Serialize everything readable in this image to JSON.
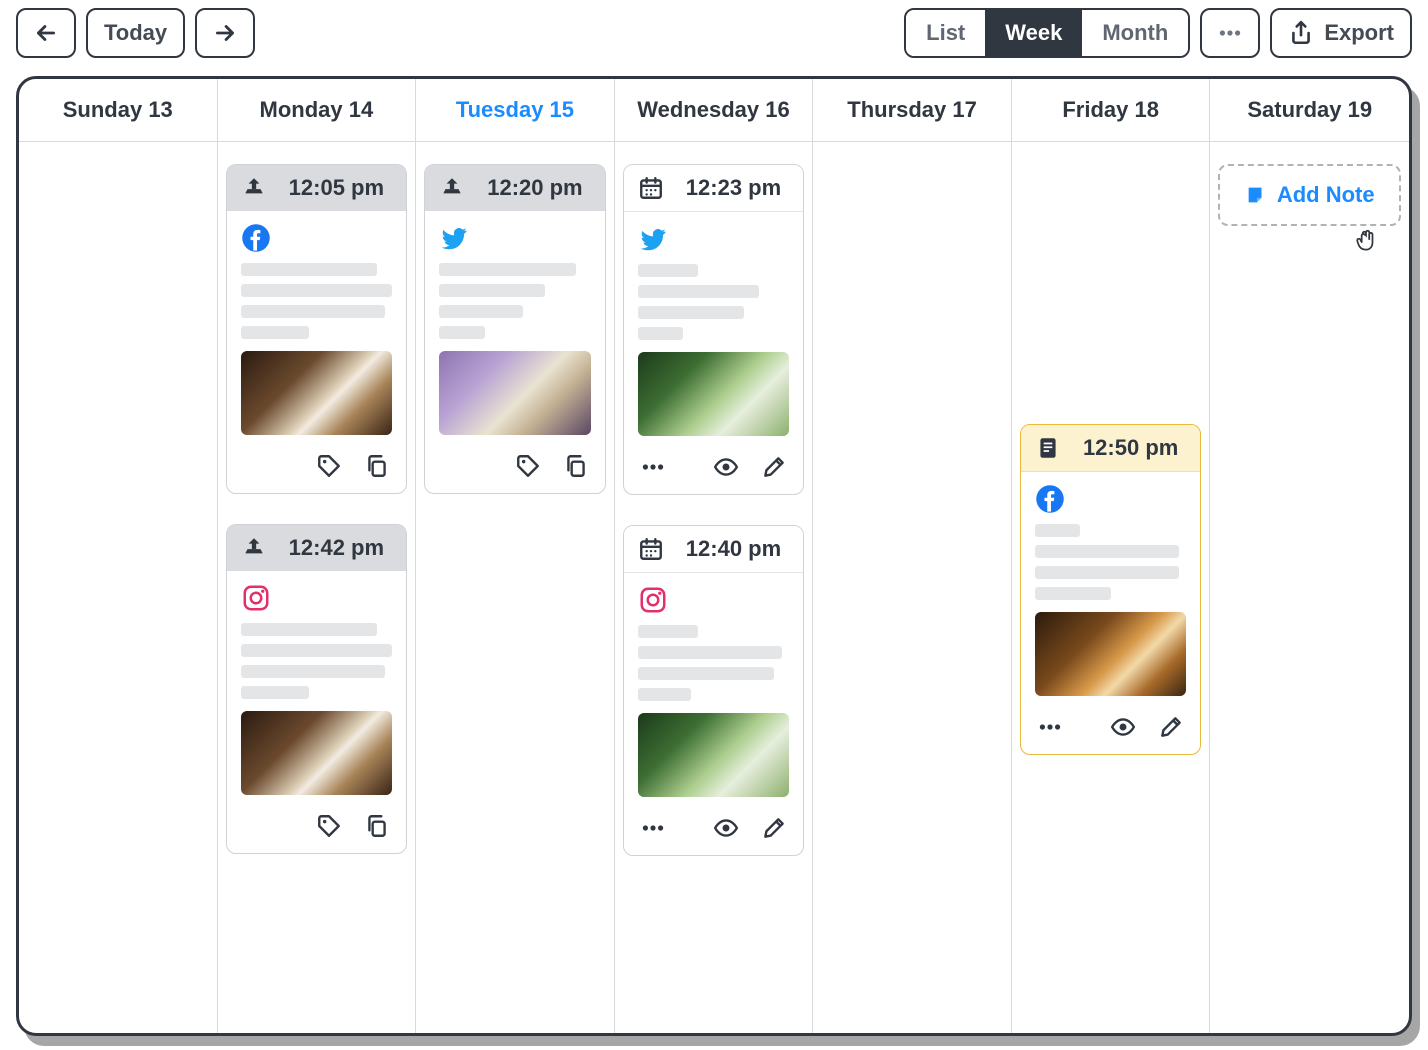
{
  "toolbar": {
    "today_label": "Today",
    "views": {
      "list": "List",
      "week": "Week",
      "month": "Month",
      "active": "week"
    },
    "export_label": "Export"
  },
  "add_note": {
    "label": "Add Note"
  },
  "days": [
    {
      "label": "Sunday 13",
      "today": false
    },
    {
      "label": "Monday 14",
      "today": false
    },
    {
      "label": "Tuesday 15",
      "today": true
    },
    {
      "label": "Wednesday 16",
      "today": false
    },
    {
      "label": "Thursday 17",
      "today": false
    },
    {
      "label": "Friday 18",
      "today": false
    },
    {
      "label": "Saturday 19",
      "today": false
    }
  ],
  "cards": {
    "mon1": {
      "time": "12:05 pm",
      "status": "queued",
      "platform": "facebook",
      "image": "coffee",
      "actions": [
        "tag",
        "copy"
      ]
    },
    "mon2": {
      "time": "12:42 pm",
      "status": "queued",
      "platform": "instagram",
      "image": "coffee",
      "actions": [
        "tag",
        "copy"
      ]
    },
    "tue1": {
      "time": "12:20 pm",
      "status": "queued",
      "platform": "twitter",
      "image": "lilac",
      "actions": [
        "tag",
        "copy"
      ]
    },
    "wed1": {
      "time": "12:23 pm",
      "status": "scheduled",
      "platform": "twitter",
      "image": "matcha",
      "actions": [
        "more",
        "view",
        "edit"
      ]
    },
    "wed2": {
      "time": "12:40 pm",
      "status": "scheduled",
      "platform": "instagram",
      "image": "matcha",
      "actions": [
        "more",
        "view",
        "edit"
      ]
    },
    "fri1": {
      "time": "12:50 pm",
      "status": "note",
      "platform": "facebook",
      "image": "whiskey",
      "actions": [
        "more",
        "view",
        "edit"
      ]
    }
  }
}
